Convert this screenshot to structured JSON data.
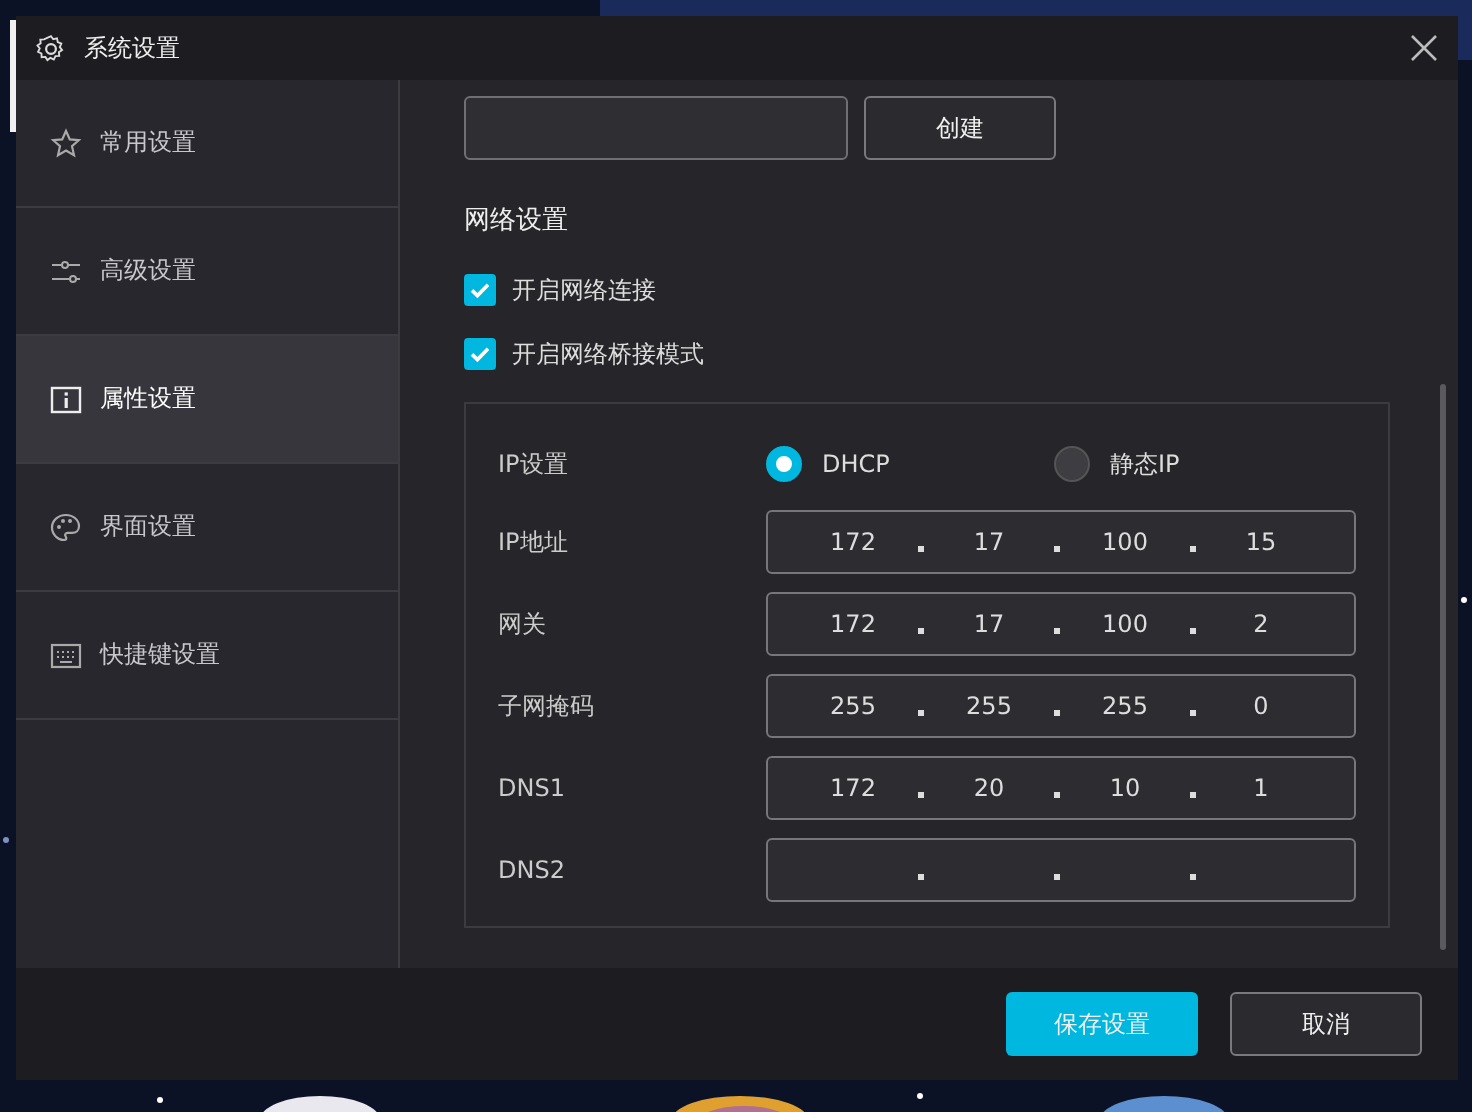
{
  "window": {
    "title": "系统设置"
  },
  "sidebar": {
    "items": [
      {
        "label": "常用设置",
        "selected": false
      },
      {
        "label": "高级设置",
        "selected": false
      },
      {
        "label": "属性设置",
        "selected": true
      },
      {
        "label": "界面设置",
        "selected": false
      },
      {
        "label": "快捷键设置",
        "selected": false
      }
    ]
  },
  "create": {
    "button": "创建"
  },
  "network": {
    "heading": "网络设置",
    "checkboxes": [
      {
        "label": "开启网络连接",
        "checked": true
      },
      {
        "label": "开启网络桥接模式",
        "checked": true
      }
    ],
    "ip_mode": {
      "label": "IP设置",
      "options": [
        {
          "label": "DHCP",
          "selected": true
        },
        {
          "label": "静态IP",
          "selected": false
        }
      ]
    },
    "fields": [
      {
        "label": "IP地址",
        "octets": [
          "172",
          "17",
          "100",
          "15"
        ]
      },
      {
        "label": "网关",
        "octets": [
          "172",
          "17",
          "100",
          "2"
        ]
      },
      {
        "label": "子网掩码",
        "octets": [
          "255",
          "255",
          "255",
          "0"
        ]
      },
      {
        "label": "DNS1",
        "octets": [
          "172",
          "20",
          "10",
          "1"
        ]
      },
      {
        "label": "DNS2"
      }
    ]
  },
  "buttons": [
    {
      "label": "保存设置",
      "kind": "primary"
    },
    {
      "label": "取消",
      "kind": "secondary"
    }
  ]
}
